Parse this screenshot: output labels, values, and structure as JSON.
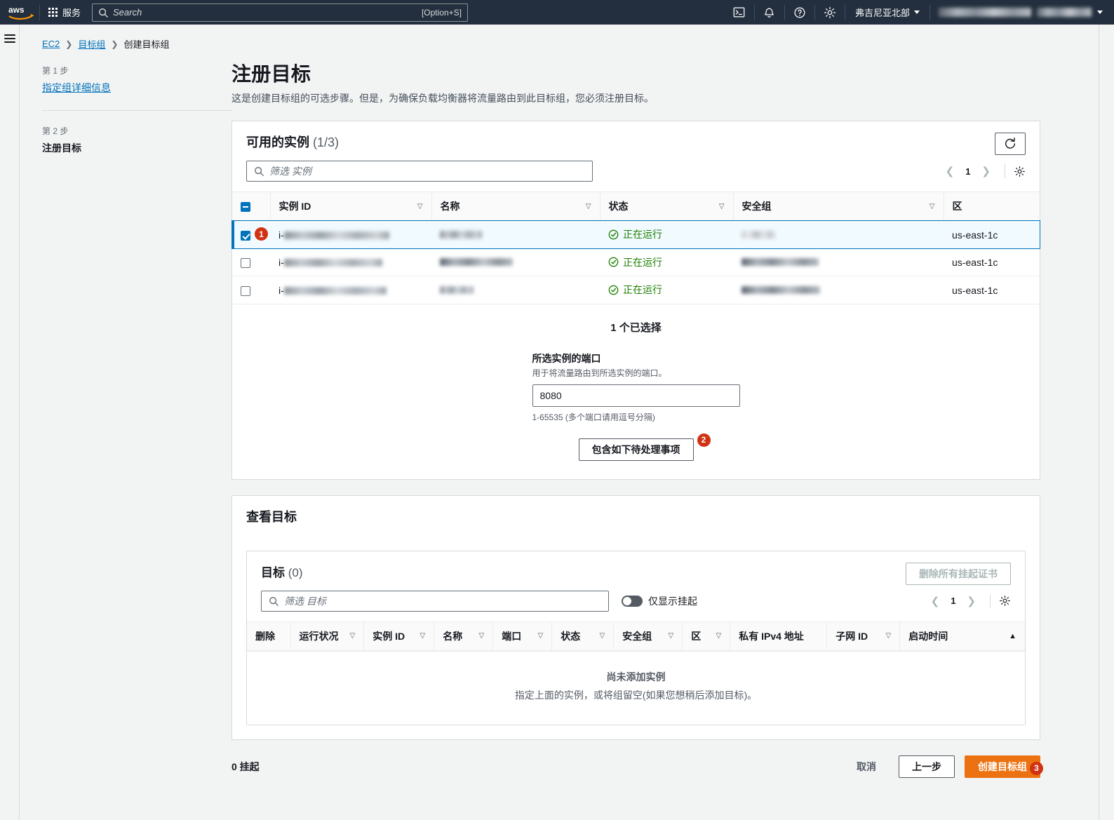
{
  "navbar": {
    "logo_alt": "aws-logo",
    "services_label": "服务",
    "search_placeholder": "Search",
    "search_shortcut": "[Option+S]",
    "icons": [
      "cloudshell-icon",
      "bell-icon",
      "help-icon",
      "settings-icon"
    ],
    "region_label": "弗吉尼亚北部",
    "account_label": ""
  },
  "breadcrumb": {
    "items": [
      {
        "label": "EC2",
        "link": true
      },
      {
        "label": "目标组",
        "link": true
      },
      {
        "label": "创建目标组",
        "link": false
      }
    ],
    "separator": "❯"
  },
  "steps": [
    {
      "num": "第 1 步",
      "label": "指定组详细信息",
      "current": false
    },
    {
      "num": "第 2 步",
      "label": "注册目标",
      "current": true
    }
  ],
  "page": {
    "title": "注册目标",
    "description": "这是创建目标组的可选步骤。但是，为确保负载均衡器将流量路由到此目标组，您必须注册目标。"
  },
  "instances_panel": {
    "title": "可用的实例",
    "count": "(1/3)",
    "refresh_icon": "refresh-icon",
    "filter_placeholder": "筛选 实例",
    "pagination": {
      "prev": "❮",
      "page": "1",
      "next": "❯"
    },
    "settings_icon": "gear-icon",
    "columns": [
      "实例 ID",
      "名称",
      "状态",
      "安全组",
      "区"
    ],
    "rows": [
      {
        "selected": true,
        "annotation": "1",
        "instance_id_prefix": "i-",
        "status": "正在运行",
        "zone": "us-east-1c"
      },
      {
        "selected": false,
        "annotation": "",
        "instance_id_prefix": "i-",
        "status": "正在运行",
        "zone": "us-east-1c"
      },
      {
        "selected": false,
        "annotation": "",
        "instance_id_prefix": "i-",
        "status": "正在运行",
        "zone": "us-east-1c"
      }
    ],
    "selection": {
      "selected_count_text": "1 个已选择",
      "port_label": "所选实例的端口",
      "port_hint": "用于将流量路由到所选实例的端口。",
      "port_value": "8080",
      "port_constraint": "1-65535 (多个端口请用逗号分隔)",
      "include_button_label": "包含如下待处理事项",
      "include_button_badge": "2"
    }
  },
  "targets_panel": {
    "section_title": "查看目标",
    "title": "目标",
    "count": "(0)",
    "delete_all_label": "删除所有挂起证书",
    "filter_placeholder": "筛选 目标",
    "toggle_label": "仅显示挂起",
    "pagination": {
      "prev": "❮",
      "page": "1",
      "next": "❯"
    },
    "settings_icon": "gear-icon",
    "columns": [
      "删除",
      "运行状况",
      "实例 ID",
      "名称",
      "端口",
      "状态",
      "安全组",
      "区",
      "私有 IPv4 地址",
      "子网 ID",
      "启动时间"
    ],
    "sorted_column": "启动时间",
    "sort_direction": "▲",
    "empty_title": "尚未添加实例",
    "empty_sub": "指定上面的实例，或将组留空(如果您想稍后添加目标)。"
  },
  "footer": {
    "pending_text": "0 挂起",
    "cancel_label": "取消",
    "previous_label": "上一步",
    "create_label": "创建目标组",
    "create_badge": "3"
  },
  "colors": {
    "nav_bg": "#232f3e",
    "accent_orange": "#ec7211",
    "link_blue": "#0073bb",
    "status_green": "#1d8102",
    "badge_red": "#d13212"
  }
}
